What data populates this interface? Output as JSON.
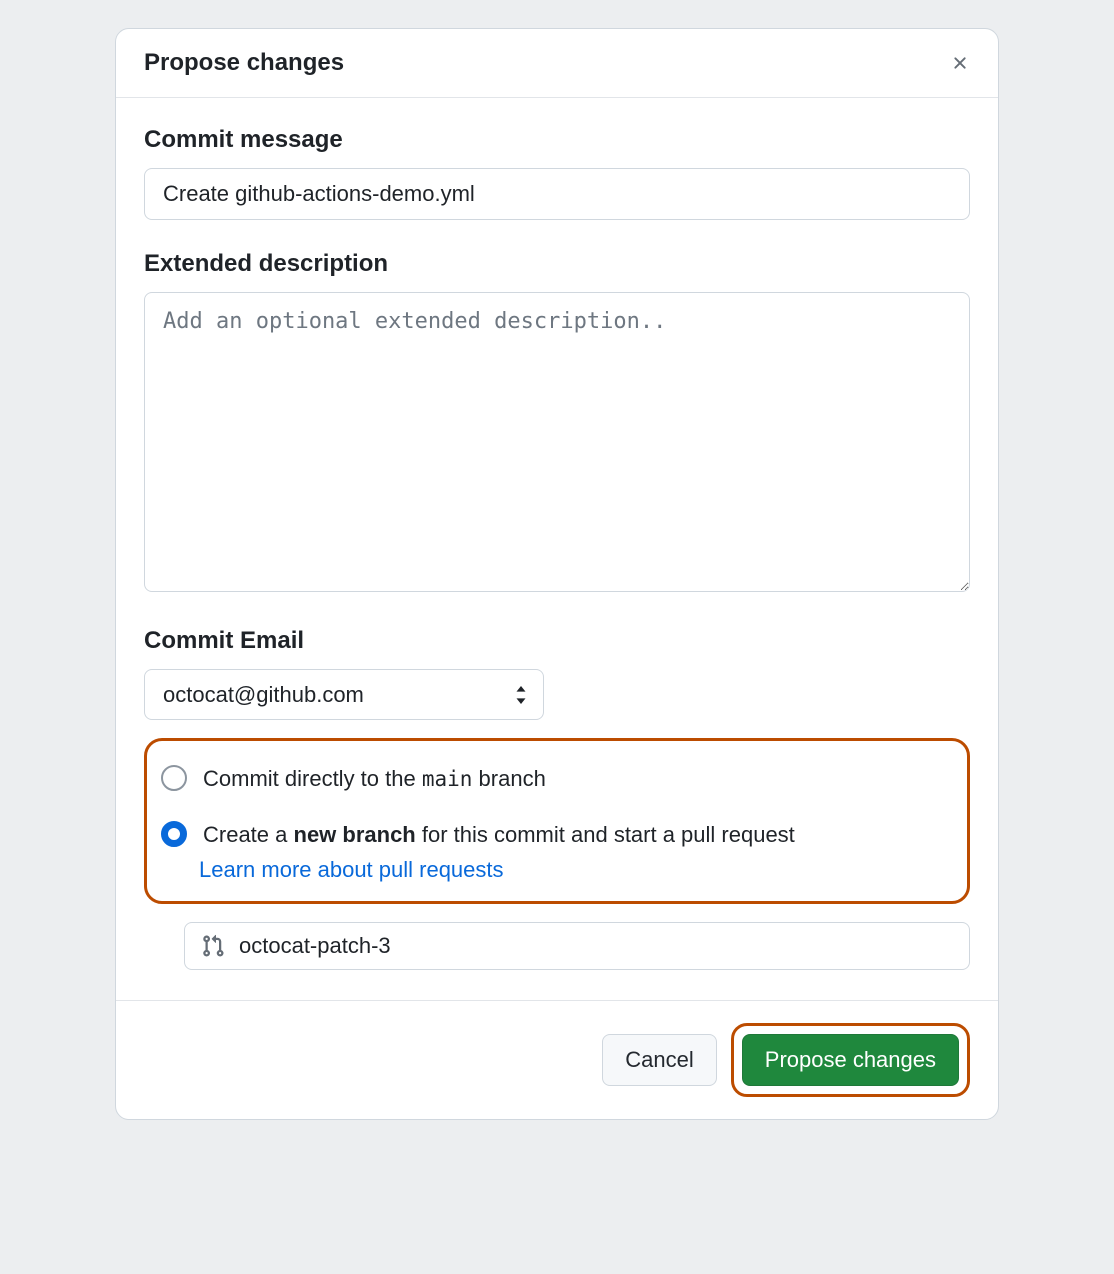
{
  "dialog": {
    "title": "Propose changes"
  },
  "commit_message": {
    "label": "Commit message",
    "value": "Create github-actions-demo.yml"
  },
  "extended_description": {
    "label": "Extended description",
    "placeholder": "Add an optional extended description.."
  },
  "commit_email": {
    "label": "Commit Email",
    "value": "octocat@github.com"
  },
  "branch_choice": {
    "direct_prefix": "Commit directly to the ",
    "direct_branch": "main",
    "direct_suffix": " branch",
    "new_prefix": "Create a ",
    "new_bold": "new branch",
    "new_suffix": " for this commit and start a pull request",
    "learn_link": "Learn more about pull requests"
  },
  "branch_name": {
    "value": "octocat-patch-3"
  },
  "footer": {
    "cancel": "Cancel",
    "submit": "Propose changes"
  }
}
